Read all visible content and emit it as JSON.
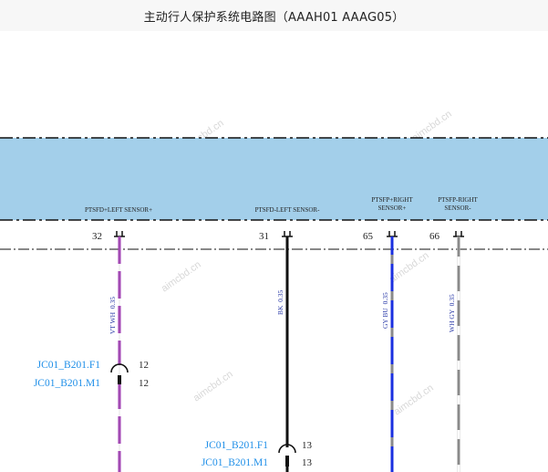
{
  "header": {
    "title": "主动行人保护系统电路图（AAAH01 AAAG05）"
  },
  "module": {
    "fill_color": "#a3cfea",
    "pins": [
      {
        "label": "PTSFD+LEFT SENSOR+",
        "label2": "",
        "number": "32",
        "wire_code": "VT WH  0.35"
      },
      {
        "label": "PTSFD-LEFT SENSOR-",
        "label2": "",
        "number": "31",
        "wire_code": "BK  0.35"
      },
      {
        "label": "PTSFP+RIGHT",
        "label2": "SENSOR+",
        "number": "65",
        "wire_code": "GY BU  0.35"
      },
      {
        "label": "PTSFP-RIGHT",
        "label2": "SENSOR-",
        "number": "66",
        "wire_code": "WH GY  0.35"
      }
    ]
  },
  "inline_connectors": [
    {
      "female": "JC01_B201.F1",
      "male": "JC01_B201.M1",
      "pin_f": "12",
      "pin_m": "12"
    },
    {
      "female": "JC01_B201.F1",
      "male": "JC01_B201.M1",
      "pin_f": "13",
      "pin_m": "13"
    }
  ],
  "watermark": "aimcbd.cn",
  "colors": {
    "violet": "#9b2fb0",
    "white": "#ffffff",
    "black": "#111111",
    "gray": "#8a8a8a",
    "blue": "#1a2fe0",
    "connector_text": "#1f8fe8"
  }
}
